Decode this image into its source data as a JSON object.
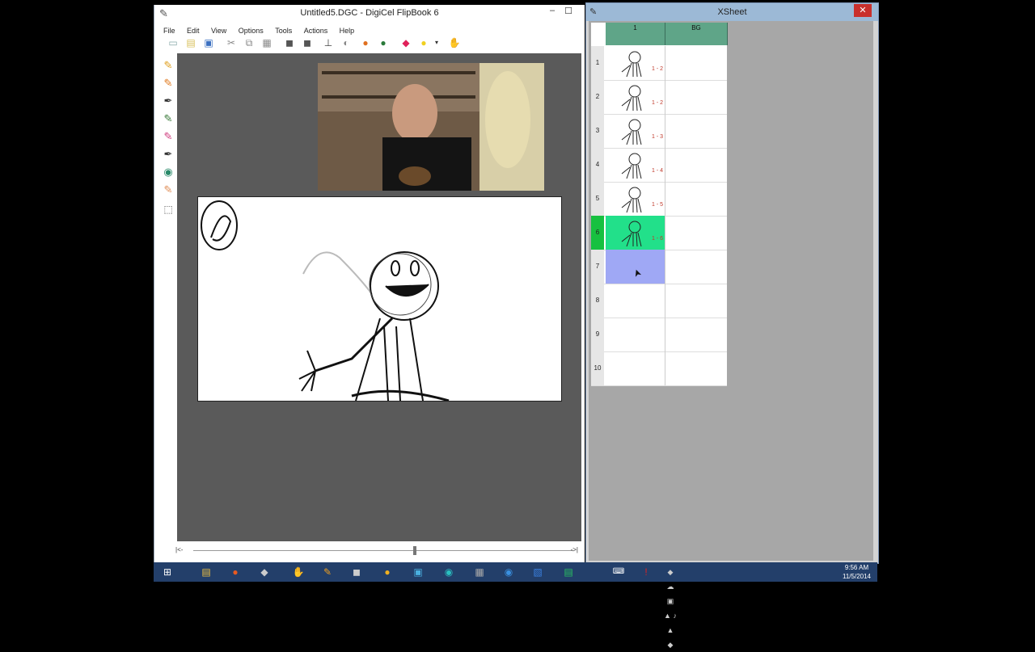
{
  "main_window": {
    "title": "Untitled5.DGC - DigiCel FlipBook 6",
    "minimize": "–",
    "maximize": "☐",
    "menu": [
      "File",
      "Edit",
      "View",
      "Options",
      "Tools",
      "Actions",
      "Help"
    ],
    "toolbar_icons": [
      "new-icon",
      "open-icon",
      "save-icon",
      "cut-icon",
      "copy-icon",
      "paste-icon",
      "camera-icon",
      "scan-icon",
      "light-table-icon",
      "color-icon",
      "paint-icon",
      "stop-icon",
      "bulb-icon",
      "dropdown-icon",
      "hand-icon"
    ],
    "tool_icons": [
      "pencil-icon",
      "brush-icon",
      "pen-icon",
      "marker-icon",
      "eraser-icon",
      "ink-icon",
      "fill-icon",
      "smudge-icon",
      "select-icon"
    ],
    "scroll_left": "|<-",
    "scroll_right": "->|"
  },
  "xsheet": {
    "title": "XSheet",
    "close": "✕",
    "columns": [
      {
        "title": "1"
      },
      {
        "title": "BG"
      }
    ],
    "rows": [
      {
        "num": "1",
        "frame": "1 - 2",
        "state": "normal"
      },
      {
        "num": "2",
        "frame": "1 - 2",
        "state": "normal"
      },
      {
        "num": "3",
        "frame": "1 - 3",
        "state": "normal"
      },
      {
        "num": "4",
        "frame": "1 - 4",
        "state": "normal"
      },
      {
        "num": "5",
        "frame": "1 - 5",
        "state": "normal"
      },
      {
        "num": "6",
        "frame": "1 - 6",
        "state": "current"
      },
      {
        "num": "7",
        "frame": "",
        "state": "selected"
      },
      {
        "num": "8",
        "frame": "",
        "state": "empty"
      },
      {
        "num": "9",
        "frame": "",
        "state": "empty"
      },
      {
        "num": "10",
        "frame": "",
        "state": "empty"
      }
    ],
    "colors": {
      "current": "#22e08a",
      "current_num": "#17c140",
      "selected": "#9fa8f5",
      "header": "#5fa588"
    }
  },
  "taskbar": {
    "time": "9:56 AM",
    "date": "11/5/2014"
  }
}
